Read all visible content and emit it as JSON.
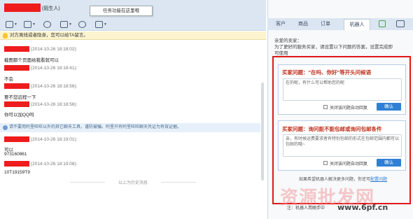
{
  "window": {
    "title_suffix": "(陌生人)"
  },
  "toolbar": {
    "tooltip": "任务功能在这里哦"
  },
  "notice": {
    "text": "对方离线或者隐身，您可以给TA留言。"
  },
  "messages": [
    {
      "time": "(2014-10-26 18:18:02):",
      "text": "截图那个页面给我看就可以"
    },
    {
      "time": "(2014-10-26 18:18:41):",
      "text": "不会"
    },
    {
      "time": "(2014-10-26 18:18:56):",
      "text": "要不您远程一下"
    },
    {
      "time": "(2014-10-26 18:18:56):",
      "text": "你可以加QQ吗"
    },
    {
      "time": "(2014-10-26 18:19:01):",
      "text": "可以"
    },
    {
      "time": "(2014-10-26 18:19:08):",
      "text": "10T19159T9"
    }
  ],
  "message_extra": "973160861",
  "warning": {
    "text": "请不要用阿里旺旺以外的其它聊天工具，谨防被骗。阿里只有阿里旺旺聊天凭证为有效证据。"
  },
  "history_divider": "以上为历史消息",
  "right_tabs": [
    {
      "label": "客户"
    },
    {
      "label": "商品"
    },
    {
      "label": "订单"
    },
    {
      "label": "机器人"
    }
  ],
  "greeting": [
    "亲爱的卖家：",
    "为了更好的服务买家，请设置以下问题的答案，设置完成即",
    "可使用"
  ],
  "cards": [
    {
      "title": "买家问题：\"在吗、你好\"等开头问候语",
      "answer": "在的呢，有什么可以帮助您的呢",
      "checkbox": "关闭该问题自动回复",
      "button": "确认"
    },
    {
      "title": "买家问题：询问能不能包邮或询问包邮条件",
      "answer": "亲，有时候运费要求者有特别包邮的形式在包邮范围内都可以包邮的哦~",
      "checkbox": "关闭该问题自动回复",
      "button": "确认"
    }
  ],
  "footer": {
    "prefix": "如果希望机器人解决更多问题，你还可",
    "link": "配置问题"
  },
  "bottom_note": "注：机器人用随手中",
  "watermark": {
    "text": "资源批发网",
    "url": "www.6pf.cn"
  }
}
